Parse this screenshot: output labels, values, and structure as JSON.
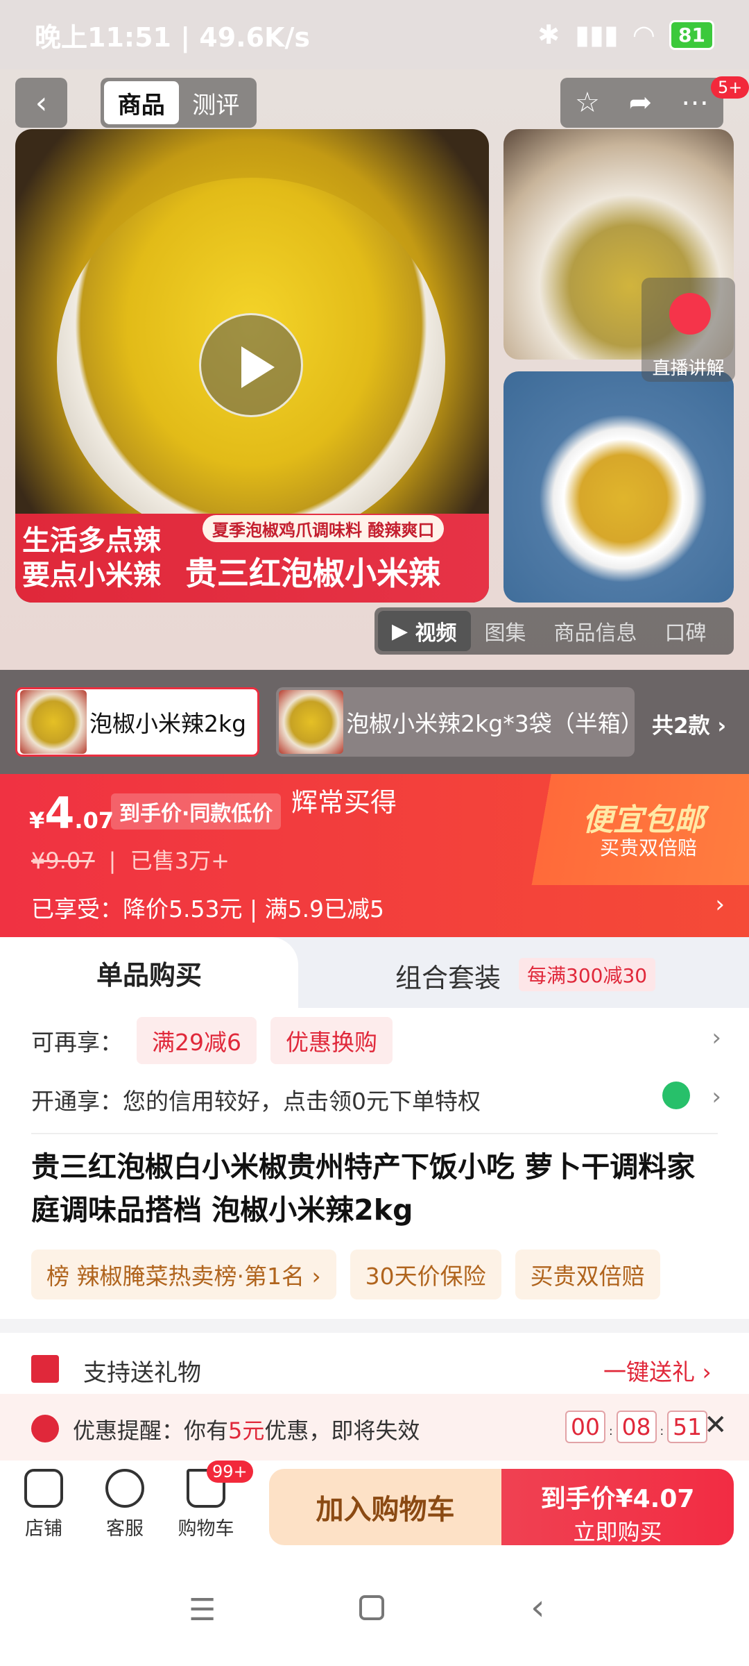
{
  "status_bar": {
    "time": "晚上11:51 | 49.6K/s",
    "battery": "81"
  },
  "nav": {
    "tabs": [
      "商品",
      "测评"
    ],
    "cart_badge": "5+"
  },
  "hero": {
    "banner_left": "生活多点辣\n要点小米辣",
    "banner_small": "夏季泡椒鸡爪调味料 酸辣爽口",
    "banner_main": "贵三红泡椒小米辣",
    "live_label": "直播讲解",
    "media_tabs": [
      "视频",
      "图集",
      "商品信息",
      "口碑"
    ]
  },
  "sku": {
    "options": [
      "泡椒小米辣2kg",
      "泡椒小米辣2kg*3袋（半箱）"
    ],
    "count": "共2款"
  },
  "price": {
    "currency": "¥",
    "main": "4",
    "decimal": ".07",
    "tag": "到手价·同款低价",
    "overlay_text": "辉常买得",
    "original": "¥9.07",
    "sold": "已售3万+",
    "enjoy": "已享受：降价5.53元 | 满5.9已减5",
    "promo_big": "便宜包邮",
    "promo_small": "买贵双倍赔"
  },
  "buy_modes": {
    "single": "单品购买",
    "combo": "组合套装",
    "combo_tag": "每满300减30"
  },
  "benefits": {
    "label": "可再享：",
    "chips": [
      "满29减6",
      "优惠换购"
    ],
    "open_text": "开通享：您的信用较好，点击领0元下单特权"
  },
  "product": {
    "title": "贵三红泡椒白小米椒贵州特产下饭小吃 萝卜干调料家庭调味品搭档 泡椒小米辣2kg",
    "tags": [
      "榜 辣椒腌菜热卖榜·第1名 ›",
      "30天价保险",
      "买贵双倍赔"
    ]
  },
  "gift": {
    "label": "支持送礼物",
    "action": "一键送礼"
  },
  "reminder": {
    "text_a": "优惠提醒：你有",
    "amount": "5元",
    "text_b": "优惠，即将失效",
    "h": "00",
    "m": "08",
    "s": "51"
  },
  "bottom": {
    "icons": [
      "店铺",
      "客服",
      "购物车"
    ],
    "cart_badge": "99+",
    "add_cart": "加入购物车",
    "buy_top": "到手价¥4.07",
    "buy_bottom": "立即购买"
  },
  "colors": {
    "accent": "#e0283a",
    "orange": "#f54b37"
  }
}
